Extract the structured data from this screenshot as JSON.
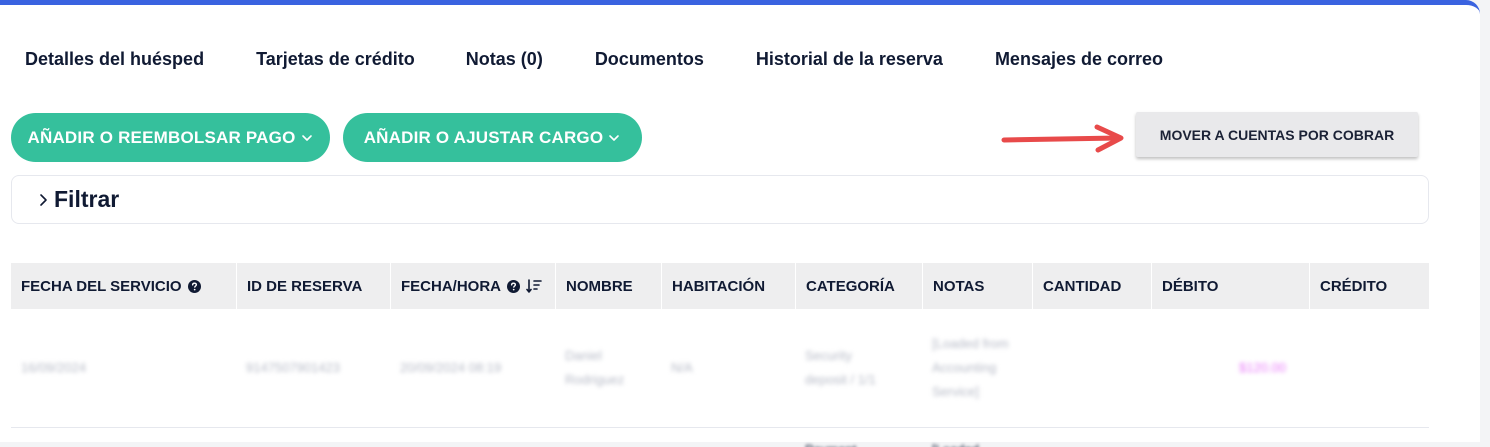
{
  "tabs": [
    {
      "label": "Detalles del huésped"
    },
    {
      "label": "Tarjetas de crédito"
    },
    {
      "label": "Notas (0)"
    },
    {
      "label": "Documentos"
    },
    {
      "label": "Historial de la reserva"
    },
    {
      "label": "Mensajes de correo"
    }
  ],
  "actions": {
    "add_refund_payment": "AÑADIR O REEMBOLSAR PAGO",
    "add_adjust_charge": "AÑADIR O AJUSTAR CARGO",
    "move_to_receivables": "MOVER A CUENTAS POR COBRAR"
  },
  "filter": {
    "label": "Filtrar"
  },
  "table": {
    "headers": {
      "service_date": "FECHA DEL SERVICIO",
      "reservation_id": "ID DE RESERVA",
      "date_time": "FECHA/HORA",
      "name": "NOMBRE",
      "room": "HABITACIÓN",
      "category": "CATEGORÍA",
      "notes": "NOTAS",
      "quantity": "CANTIDAD",
      "debit": "DÉBITO",
      "credit": "CRÉDITO"
    },
    "rows": [
      {
        "service_date": "16/09/2024",
        "reservation_id": "9147507901423",
        "date_time": "20/09/2024 08:19",
        "name": "Daniel Rodriguez",
        "room": "N/A",
        "category": "Security deposit / 1/1",
        "notes": "[Loaded from Accounting Service]",
        "quantity": "",
        "debit": "$120.00",
        "credit": ""
      },
      {
        "category": "Payment",
        "notes": "[Loaded"
      }
    ]
  },
  "colors": {
    "accent_green": "#35c09c",
    "top_border_blue": "#3a63e0",
    "annotation_arrow": "#e84a4a",
    "debit_pink": "#e879f9"
  }
}
